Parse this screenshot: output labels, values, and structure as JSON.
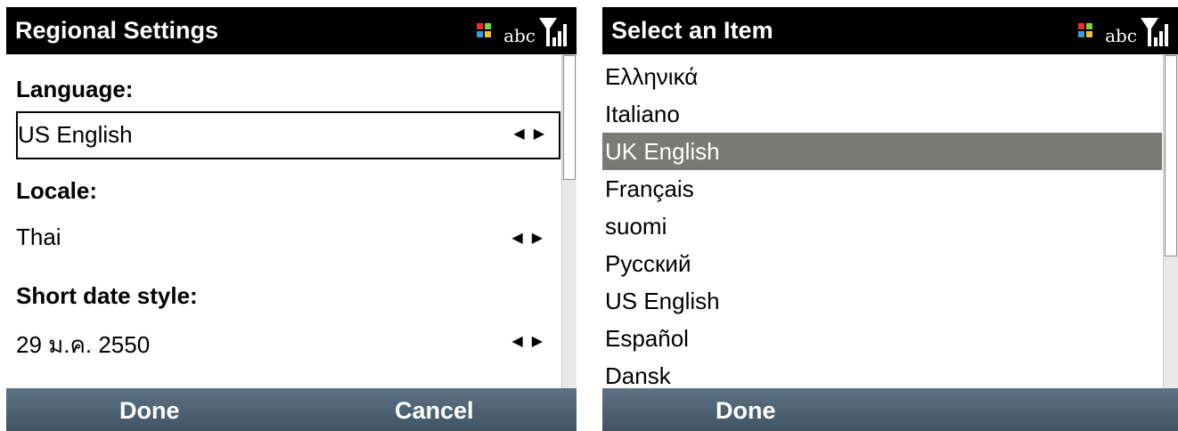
{
  "status": {
    "input_mode": "abc"
  },
  "left": {
    "title": "Regional Settings",
    "language_label": "Language:",
    "language_value": "US English",
    "locale_label": "Locale:",
    "locale_value": "Thai",
    "date_label": "Short date style:",
    "date_value": "29 ม.ค. 2550",
    "arrows": "◀▶",
    "softkey_left": "Done",
    "softkey_right": "Cancel"
  },
  "right": {
    "title": "Select an Item",
    "items": [
      "Ελληνικά",
      "Italiano",
      "UK English",
      "Français",
      "suomi",
      "Русский",
      "US English",
      "Español",
      "Dansk"
    ],
    "selected_index": 2,
    "softkey_left": "Done"
  },
  "colors": {
    "titlebar": "#000000",
    "softbar": "#4a6070",
    "selection": "#7a7a76"
  }
}
